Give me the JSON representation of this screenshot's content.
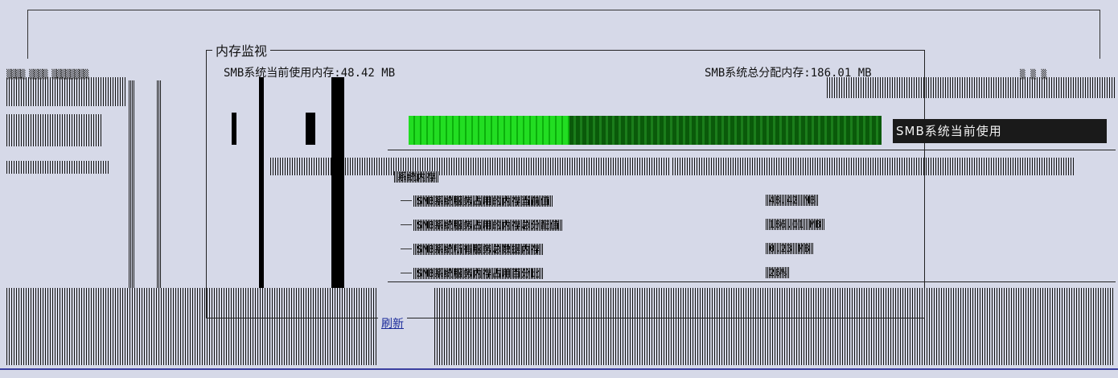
{
  "group": {
    "title": "内存监视"
  },
  "memory": {
    "current_label": "SMB系统当前使用内存:",
    "current_value": "48.42 MB",
    "total_label": "SMB系统总分配内存:",
    "total_value": "186.01 MB",
    "usage_fraction": 0.34,
    "usage_caption": "SMB系统当前使用"
  },
  "tree": {
    "root": "系统内存",
    "nodes": [
      {
        "label": "SMB系统服务占用的内存当前值",
        "value": "48.42 MB"
      },
      {
        "label": "SMB系统服务占用的内存总分配值",
        "value": "186.01 MB"
      },
      {
        "label": "SMB系统所有服务总数据内存",
        "value": "0.23 MB"
      },
      {
        "label": "SMB系统服务内存占用百分比",
        "value": "26%"
      }
    ]
  },
  "footer": {
    "link": "刷新"
  },
  "colors": {
    "progress_fill": "#22dd22",
    "progress_track": "#0a5a0a",
    "background": "#d6d9e8",
    "link": "#1a2a9a"
  }
}
